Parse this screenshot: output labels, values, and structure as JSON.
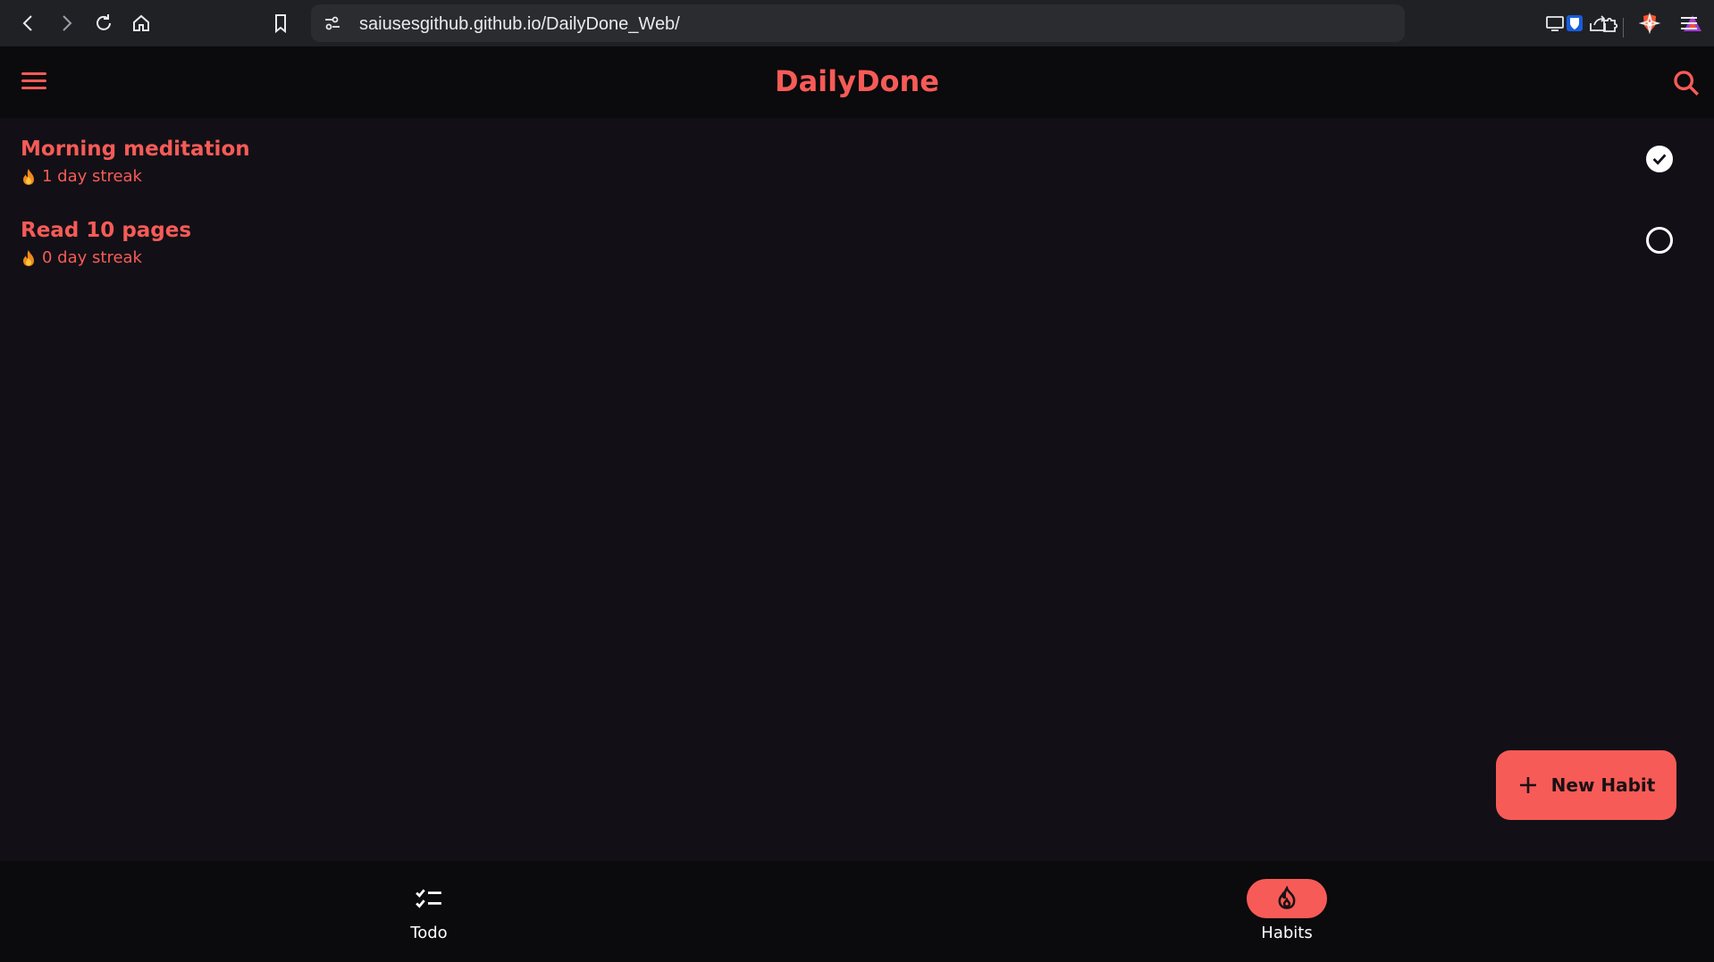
{
  "browser": {
    "url": "saiusesgithub.github.io/DailyDone_Web/"
  },
  "app": {
    "title": "DailyDone"
  },
  "habits": [
    {
      "title": "Morning meditation",
      "streak": "1 day streak",
      "done": true
    },
    {
      "title": "Read 10 pages",
      "streak": "0 day streak",
      "done": false
    }
  ],
  "fab": {
    "label": "New Habit"
  },
  "nav": {
    "items": [
      {
        "label": "Todo",
        "icon": "checklist-icon",
        "active": false
      },
      {
        "label": "Habits",
        "icon": "flame-icon",
        "active": true
      }
    ]
  },
  "colors": {
    "accent": "#f75b57",
    "background": "#121016",
    "bar": "#0b0a0c"
  }
}
